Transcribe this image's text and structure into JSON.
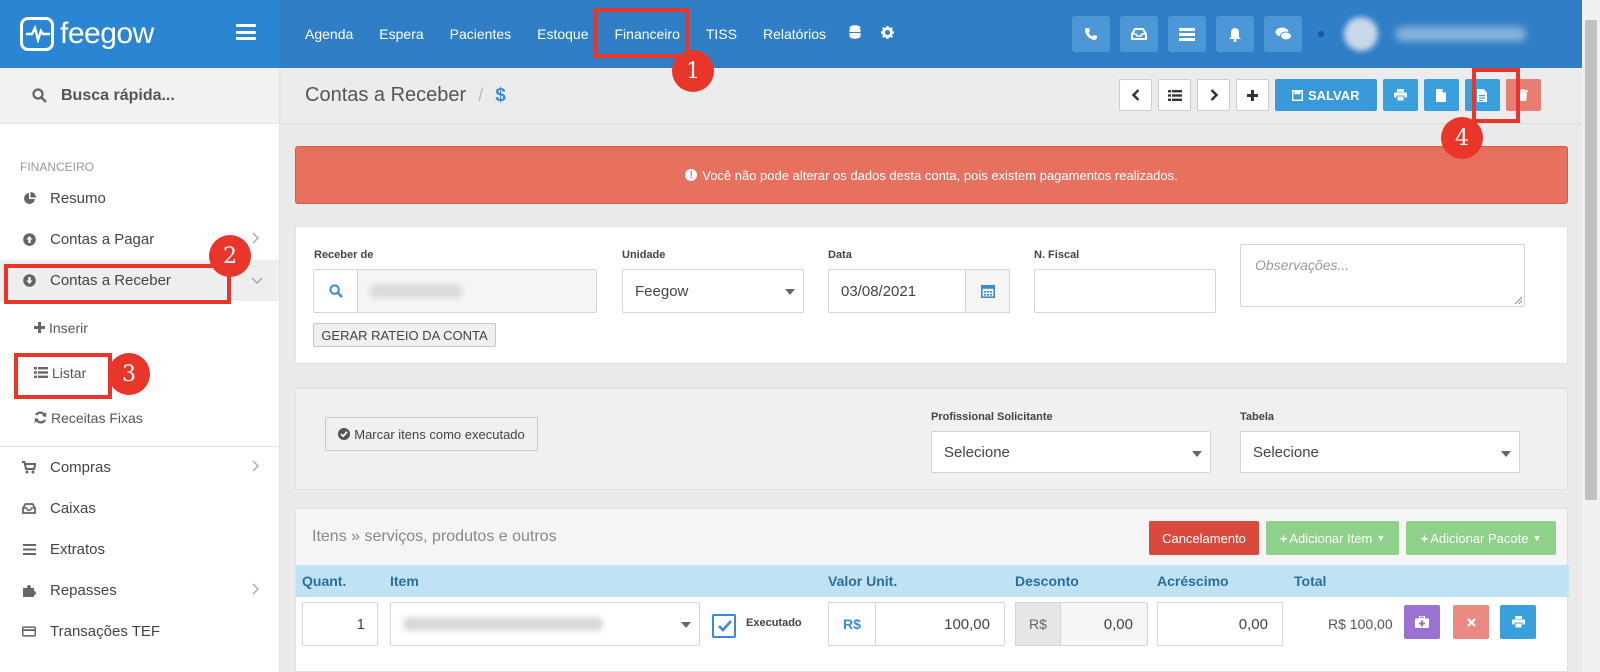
{
  "brand": {
    "name": "feegow"
  },
  "nav": {
    "items": [
      {
        "label": "Agenda"
      },
      {
        "label": "Espera"
      },
      {
        "label": "Pacientes"
      },
      {
        "label": "Estoque"
      },
      {
        "label": "Financeiro"
      },
      {
        "label": "TISS"
      },
      {
        "label": "Relatórios"
      }
    ],
    "icons": [
      "database-icon",
      "gear-icon"
    ],
    "right_icons": [
      "phone-icon",
      "inbox-icon",
      "list-icon",
      "bell-icon",
      "chat-icon"
    ]
  },
  "steps": {
    "one": "1",
    "two": "2",
    "three": "3",
    "four": "4"
  },
  "sidebar": {
    "search_label": "Busca rápida...",
    "section_title": "FINANCEIRO",
    "items": [
      {
        "label": "Resumo",
        "icon": "pie-chart-icon"
      },
      {
        "label": "Contas a Pagar",
        "icon": "arrow-up-circle-icon"
      },
      {
        "label": "Contas a Receber",
        "icon": "arrow-down-circle-icon"
      }
    ],
    "sub_items": [
      {
        "label": "Inserir",
        "icon": "plus-icon"
      },
      {
        "label": "Listar",
        "icon": "list-icon"
      },
      {
        "label": "Receitas Fixas",
        "icon": "refresh-icon"
      }
    ],
    "more_items": [
      {
        "label": "Compras",
        "icon": "cart-icon"
      },
      {
        "label": "Caixas",
        "icon": "inbox-icon"
      },
      {
        "label": "Extratos",
        "icon": "lines-icon"
      },
      {
        "label": "Repasses",
        "icon": "puzzle-icon"
      },
      {
        "label": "Transações TEF",
        "icon": "credit-card-icon"
      }
    ]
  },
  "header": {
    "title": "Contas a Receber",
    "separator": "/",
    "dollar": "$",
    "save_label": "SALVAR"
  },
  "alert": {
    "message": "Você não pode alterar os dados desta conta, pois existem pagamentos realizados."
  },
  "form": {
    "receber_de_label": "Receber de",
    "unidade_label": "Unidade",
    "unidade_value": "Feegow",
    "data_label": "Data",
    "data_value": "03/08/2021",
    "nfiscal_label": "N. Fiscal",
    "nfiscal_value": "",
    "observacoes_placeholder": "Observações...",
    "rateio_button": "GERAR RATEIO DA CONTA"
  },
  "execution": {
    "marcar_button": "Marcar itens como executado",
    "profissional_label": "Profissional Solicitante",
    "profissional_value": "Selecione",
    "tabela_label": "Tabela",
    "tabela_value": "Selecione"
  },
  "items": {
    "title": "Itens » serviços, produtos e outros",
    "cancel_button": "Cancelamento",
    "add_item_button": "Adicionar Item",
    "add_package_button": "Adicionar Pacote",
    "columns": [
      "Quant.",
      "Item",
      "Valor Unit.",
      "Desconto",
      "Acréscimo",
      "Total"
    ],
    "row": {
      "quantity": "1",
      "executed_label": "Executado",
      "currency": "R$",
      "unit_value": "100,00",
      "discount_currency": "R$",
      "discount": "0,00",
      "addition": "0,00",
      "total": "R$ 100,00"
    }
  },
  "colors": {
    "topbar": "#2f7ec6",
    "brand_bg": "#2a85d2",
    "highlight": "#e8362b",
    "alert": "#e8705f",
    "table_header": "#bfe3f5"
  }
}
